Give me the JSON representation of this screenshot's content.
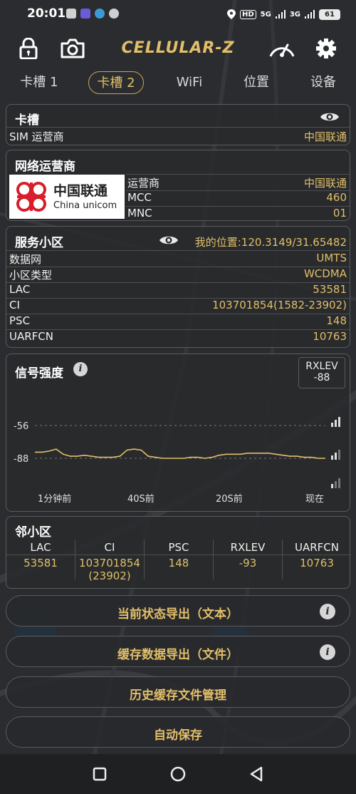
{
  "status_bar": {
    "time": "20:01",
    "net1": "HD",
    "net2": "5G",
    "net3": "3G",
    "battery": "61"
  },
  "header": {
    "app_name": "CELLULAR-Z",
    "icons": [
      "lock-icon",
      "camera-icon",
      "speedometer-icon",
      "gear-icon"
    ]
  },
  "tabs": [
    {
      "label": "卡槽 1"
    },
    {
      "label": "卡槽 2"
    },
    {
      "label": "WiFi"
    },
    {
      "label": "位置"
    },
    {
      "label": "设备"
    }
  ],
  "sim_card": {
    "title": "卡槽",
    "operator_label": "SIM 运营商",
    "operator_value": "中国联通"
  },
  "network_operator": {
    "title": "网络运营商",
    "logo_cn": "中国联通",
    "logo_en": "China unicom",
    "rows": [
      {
        "k": "运营商",
        "v": "中国联通"
      },
      {
        "k": "MCC",
        "v": "460"
      },
      {
        "k": "MNC",
        "v": "01"
      }
    ]
  },
  "serving_cell": {
    "title": "服务小区",
    "location": "我的位置:120.3149/31.65482",
    "rows": [
      {
        "k": "数据网",
        "v": "UMTS"
      },
      {
        "k": "小区类型",
        "v": "WCDMA"
      },
      {
        "k": "LAC",
        "v": "53581"
      },
      {
        "k": "CI",
        "v": "103701854(1582-23902)"
      },
      {
        "k": "PSC",
        "v": "148"
      },
      {
        "k": "UARFCN",
        "v": "10763"
      }
    ]
  },
  "signal": {
    "title": "信号强度",
    "metric_label": "RXLEV",
    "metric_value": "-88",
    "y_ticks": [
      "-56",
      "-88"
    ],
    "x_ticks": [
      "1分钟前",
      "40S前",
      "20S前",
      "现在"
    ],
    "line_color": "#e2bf6a"
  },
  "chart_data": {
    "type": "line",
    "title": "信号强度",
    "ylabel": "RXLEV",
    "y_ticks": [
      -56,
      -88
    ],
    "x_ticks": [
      "1分钟前",
      "40S前",
      "20S前",
      "现在"
    ],
    "ylim": [
      -100,
      -50
    ],
    "series": [
      {
        "name": "RXLEV",
        "color": "#e2bf6a",
        "values": [
          -82,
          -82,
          -81,
          -79,
          -84,
          -86,
          -86,
          -85,
          -86,
          -87,
          -87,
          -87,
          -86,
          -80,
          -79,
          -80,
          -86,
          -87,
          -88,
          -88,
          -88,
          -88,
          -87,
          -87,
          -88,
          -87,
          -85,
          -84,
          -84,
          -84,
          -83,
          -83,
          -83,
          -83,
          -84,
          -85,
          -86,
          -86,
          -87,
          -87,
          -88,
          -88
        ]
      }
    ]
  },
  "neighbor": {
    "title": "邻小区",
    "headers": [
      "LAC",
      "CI",
      "PSC",
      "RXLEV",
      "UARFCN"
    ],
    "row": [
      "53581",
      "103701854",
      "148",
      "-93",
      "10763"
    ],
    "ci_sub": "(23902)"
  },
  "buttons": [
    {
      "label": "当前状态导出（文本）",
      "info": "i"
    },
    {
      "label": "缓存数据导出（文件）",
      "info": "i"
    },
    {
      "label": "历史缓存文件管理"
    },
    {
      "label": "自动保存"
    }
  ]
}
